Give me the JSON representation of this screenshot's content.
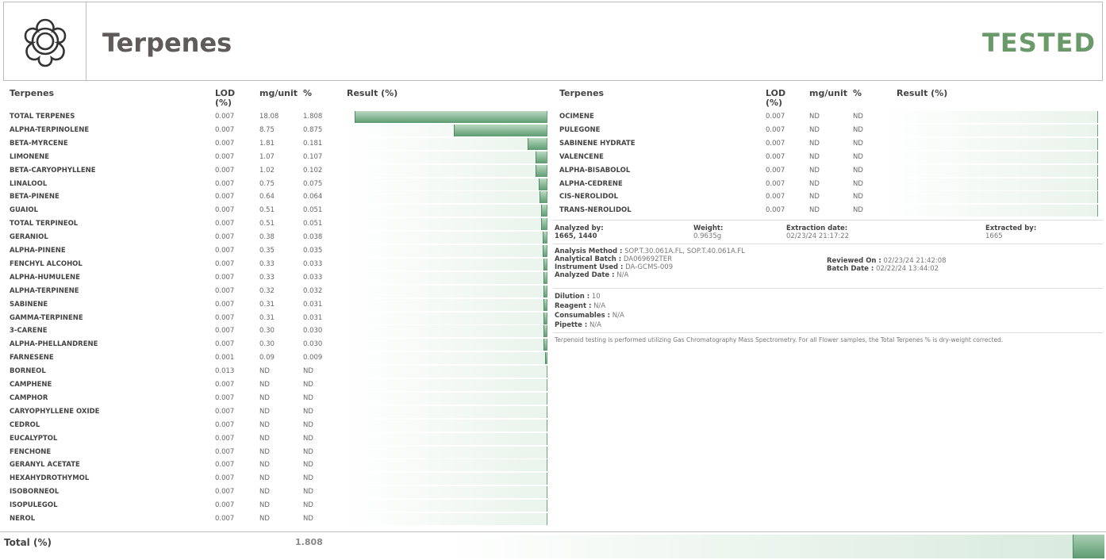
{
  "header": {
    "title": "Terpenes",
    "status": "TESTED"
  },
  "columns": {
    "name": "Terpenes",
    "lod": "LOD (%)",
    "mg": "mg/unit",
    "pct": "%",
    "result": "Result (%)"
  },
  "max_result": 1.808,
  "left_rows": [
    {
      "name": "TOTAL TERPENES",
      "lod": "0.007",
      "mg": "18.08",
      "pct": "1.808",
      "v": 1.808
    },
    {
      "name": "ALPHA-TERPINOLENE",
      "lod": "0.007",
      "mg": "8.75",
      "pct": "0.875",
      "v": 0.875
    },
    {
      "name": "BETA-MYRCENE",
      "lod": "0.007",
      "mg": "1.81",
      "pct": "0.181",
      "v": 0.181
    },
    {
      "name": "LIMONENE",
      "lod": "0.007",
      "mg": "1.07",
      "pct": "0.107",
      "v": 0.107
    },
    {
      "name": "BETA-CARYOPHYLLENE",
      "lod": "0.007",
      "mg": "1.02",
      "pct": "0.102",
      "v": 0.102
    },
    {
      "name": "LINALOOL",
      "lod": "0.007",
      "mg": "0.75",
      "pct": "0.075",
      "v": 0.075
    },
    {
      "name": "BETA-PINENE",
      "lod": "0.007",
      "mg": "0.64",
      "pct": "0.064",
      "v": 0.064
    },
    {
      "name": "GUAIOL",
      "lod": "0.007",
      "mg": "0.51",
      "pct": "0.051",
      "v": 0.051
    },
    {
      "name": "TOTAL TERPINEOL",
      "lod": "0.007",
      "mg": "0.51",
      "pct": "0.051",
      "v": 0.051
    },
    {
      "name": "GERANIOL",
      "lod": "0.007",
      "mg": "0.38",
      "pct": "0.038",
      "v": 0.038
    },
    {
      "name": "ALPHA-PINENE",
      "lod": "0.007",
      "mg": "0.35",
      "pct": "0.035",
      "v": 0.035
    },
    {
      "name": "FENCHYL ALCOHOL",
      "lod": "0.007",
      "mg": "0.33",
      "pct": "0.033",
      "v": 0.033
    },
    {
      "name": "ALPHA-HUMULENE",
      "lod": "0.007",
      "mg": "0.33",
      "pct": "0.033",
      "v": 0.033
    },
    {
      "name": "ALPHA-TERPINENE",
      "lod": "0.007",
      "mg": "0.32",
      "pct": "0.032",
      "v": 0.032
    },
    {
      "name": "SABINENE",
      "lod": "0.007",
      "mg": "0.31",
      "pct": "0.031",
      "v": 0.031
    },
    {
      "name": "GAMMA-TERPINENE",
      "lod": "0.007",
      "mg": "0.31",
      "pct": "0.031",
      "v": 0.031
    },
    {
      "name": "3-CARENE",
      "lod": "0.007",
      "mg": "0.30",
      "pct": "0.030",
      "v": 0.03
    },
    {
      "name": "ALPHA-PHELLANDRENE",
      "lod": "0.007",
      "mg": "0.30",
      "pct": "0.030",
      "v": 0.03
    },
    {
      "name": "FARNESENE",
      "lod": "0.001",
      "mg": "0.09",
      "pct": "0.009",
      "v": 0.009
    },
    {
      "name": "BORNEOL",
      "lod": "0.013",
      "mg": "ND",
      "pct": "ND",
      "v": 0
    },
    {
      "name": "CAMPHENE",
      "lod": "0.007",
      "mg": "ND",
      "pct": "ND",
      "v": 0
    },
    {
      "name": "CAMPHOR",
      "lod": "0.007",
      "mg": "ND",
      "pct": "ND",
      "v": 0
    },
    {
      "name": "CARYOPHYLLENE OXIDE",
      "lod": "0.007",
      "mg": "ND",
      "pct": "ND",
      "v": 0
    },
    {
      "name": "CEDROL",
      "lod": "0.007",
      "mg": "ND",
      "pct": "ND",
      "v": 0
    },
    {
      "name": "EUCALYPTOL",
      "lod": "0.007",
      "mg": "ND",
      "pct": "ND",
      "v": 0
    },
    {
      "name": "FENCHONE",
      "lod": "0.007",
      "mg": "ND",
      "pct": "ND",
      "v": 0
    },
    {
      "name": "GERANYL ACETATE",
      "lod": "0.007",
      "mg": "ND",
      "pct": "ND",
      "v": 0
    },
    {
      "name": "HEXAHYDROTHYMOL",
      "lod": "0.007",
      "mg": "ND",
      "pct": "ND",
      "v": 0
    },
    {
      "name": "ISOBORNEOL",
      "lod": "0.007",
      "mg": "ND",
      "pct": "ND",
      "v": 0
    },
    {
      "name": "ISOPULEGOL",
      "lod": "0.007",
      "mg": "ND",
      "pct": "ND",
      "v": 0
    },
    {
      "name": "NEROL",
      "lod": "0.007",
      "mg": "ND",
      "pct": "ND",
      "v": 0
    }
  ],
  "right_rows": [
    {
      "name": "OCIMENE",
      "lod": "0.007",
      "mg": "ND",
      "pct": "ND",
      "v": 0
    },
    {
      "name": "PULEGONE",
      "lod": "0.007",
      "mg": "ND",
      "pct": "ND",
      "v": 0
    },
    {
      "name": "SABINENE HYDRATE",
      "lod": "0.007",
      "mg": "ND",
      "pct": "ND",
      "v": 0
    },
    {
      "name": "VALENCENE",
      "lod": "0.007",
      "mg": "ND",
      "pct": "ND",
      "v": 0
    },
    {
      "name": "ALPHA-BISABOLOL",
      "lod": "0.007",
      "mg": "ND",
      "pct": "ND",
      "v": 0
    },
    {
      "name": "ALPHA-CEDRENE",
      "lod": "0.007",
      "mg": "ND",
      "pct": "ND",
      "v": 0
    },
    {
      "name": "CIS-NEROLIDOL",
      "lod": "0.007",
      "mg": "ND",
      "pct": "ND",
      "v": 0
    },
    {
      "name": "TRANS-NEROLIDOL",
      "lod": "0.007",
      "mg": "ND",
      "pct": "ND",
      "v": 0
    }
  ],
  "info": {
    "analyzed_by_label": "Analyzed by:",
    "analyzed_by": "1665, 1440",
    "weight_label": "Weight:",
    "weight": "0.9635g",
    "extraction_date_label": "Extraction date:",
    "extraction_date": "02/23/24 21:17:22",
    "extracted_by_label": "Extracted by:",
    "extracted_by": "1665",
    "analysis_method_label": "Analysis Method :",
    "analysis_method": "SOP.T.30.061A.FL, SOP.T.40.061A.FL",
    "analytical_batch_label": "Analytical Batch :",
    "analytical_batch": "DA069692TER",
    "instrument_label": "Instrument Used :",
    "instrument": "DA-GCMS-009",
    "analyzed_date_label": "Analyzed Date :",
    "analyzed_date": "N/A",
    "reviewed_on_label": "Reviewed On :",
    "reviewed_on": "02/23/24 21:42:08",
    "batch_date_label": "Batch Date :",
    "batch_date": "02/22/24 13:44:02",
    "dilution_label": "Dilution :",
    "dilution": "10",
    "reagent_label": "Reagent :",
    "reagent": "N/A",
    "consumables_label": "Consumables :",
    "consumables": "N/A",
    "pipette_label": "Pipette :",
    "pipette": "N/A",
    "note": "Terpenoid testing is performed utilizing Gas Chromatography Mass Spectrometry. For all Flower samples, the Total Terpenes % is dry-weight corrected."
  },
  "total": {
    "label": "Total (%)",
    "value": "1.808",
    "v": 1.808
  }
}
